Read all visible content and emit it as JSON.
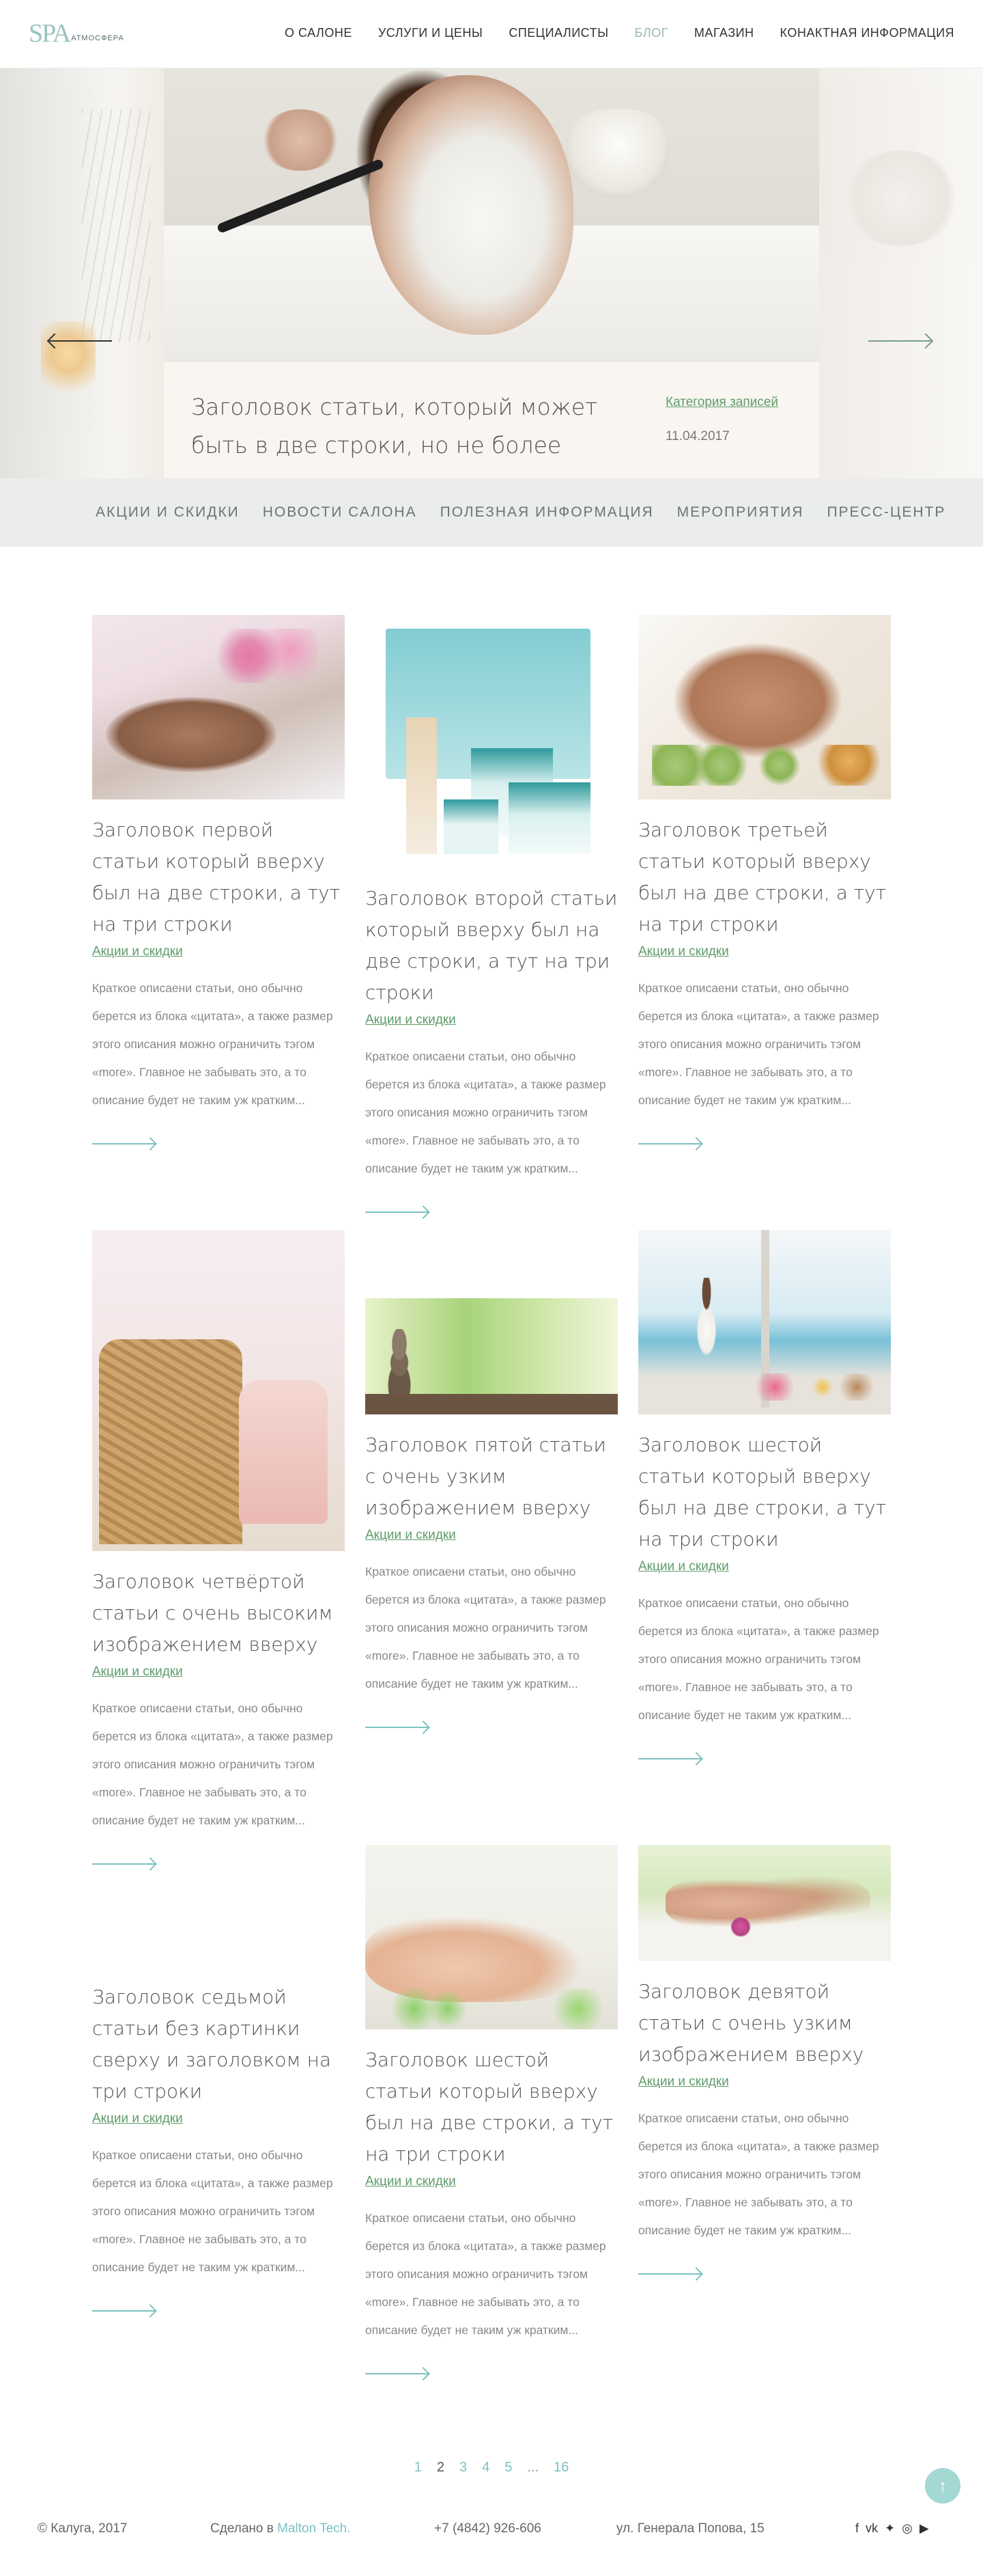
{
  "brand": {
    "mark": "SPA",
    "word": "АТМОСФЕРА"
  },
  "nav": [
    {
      "label": "О САЛОНЕ"
    },
    {
      "label": "УСЛУГИ И ЦЕНЫ"
    },
    {
      "label": "СПЕЦИАЛИСТЫ"
    },
    {
      "label": "БЛОГ",
      "active": true
    },
    {
      "label": "МАГАЗИН"
    },
    {
      "label": "КОНАКТНАЯ ИНФОРМАЦИЯ"
    }
  ],
  "hero": {
    "title": "Заголовок статьи, который может быть в две строки, но не более",
    "category": "Категория записей",
    "date": "11.04.2017"
  },
  "categories": [
    "АКЦИИ И СКИДКИ",
    "НОВОСТИ САЛОНА",
    "ПОЛЕЗНАЯ ИНФОРМАЦИЯ",
    "МЕРОПРИЯТИЯ",
    "ПРЕСС-ЦЕНТР"
  ],
  "excerpt": "Краткое описаени статьи, оно обычно берется из блока «цитата», а также размер этого описания можно ограничить тэгом «more». Главное не забывать это, а то описание будет не таким уж кратким...",
  "posts": [
    {
      "title": "Заголовок первой статьи который вверху был на две строки, а тут на три строки",
      "category": "Акции и скидки",
      "image": "spa-woman-orchid-photo"
    },
    {
      "title": "Заголовок второй статьи который вверху был на две строки, а тут на три строки",
      "category": "Акции и скидки",
      "image": "cnd-cosmetics-photo"
    },
    {
      "title": "Заголовок третьей статьи который вверху был на две строки, а тут на три строки",
      "category": "Акции и скидки",
      "image": "man-massage-photo"
    },
    {
      "title": "Заголовок четвёртой статьи с очень высоким изображением вверху",
      "category": "Акции и скидки",
      "image": "towels-basket-photo"
    },
    {
      "title": "Заголовок пятой статьи с очень узким изображением вверху",
      "category": "Акции и скидки",
      "image": "zen-stones-photo"
    },
    {
      "title": "Заголовок шестой статьи который вверху был на две строки, а тут на три строки",
      "category": "Акции и скидки",
      "image": "woman-sea-view-photo"
    },
    {
      "title": "Заголовок седьмой статьи без картинки сверху и заголовком на три строки",
      "category": "Акции и скидки",
      "image": ""
    },
    {
      "title": "Заголовок шестой статьи который вверху был на две строки, а тут на три строки",
      "category": "Акции и скидки",
      "image": "woman-back-massage-photo"
    },
    {
      "title": "Заголовок девятой статьи с очень узким изображением вверху",
      "category": "Акции и скидки",
      "image": "couple-massage-photo"
    }
  ],
  "pagination": {
    "pages": [
      "1",
      "2",
      "3",
      "4",
      "5",
      "...",
      "16"
    ],
    "current": "2"
  },
  "footer": {
    "copyright": "© Калуга, 2017",
    "made_prefix": "Сделано в",
    "made_by": "Malton Tech.",
    "phone": "+7 (4842) 926-606",
    "address": "ул. Генерала Попова, 15",
    "social": [
      "f",
      "vk",
      "twitter",
      "instagram",
      "youtube"
    ]
  },
  "colors": {
    "accent": "#7cc1c1",
    "category_link": "#5f9c6a",
    "category_bar": "#ebeded"
  }
}
